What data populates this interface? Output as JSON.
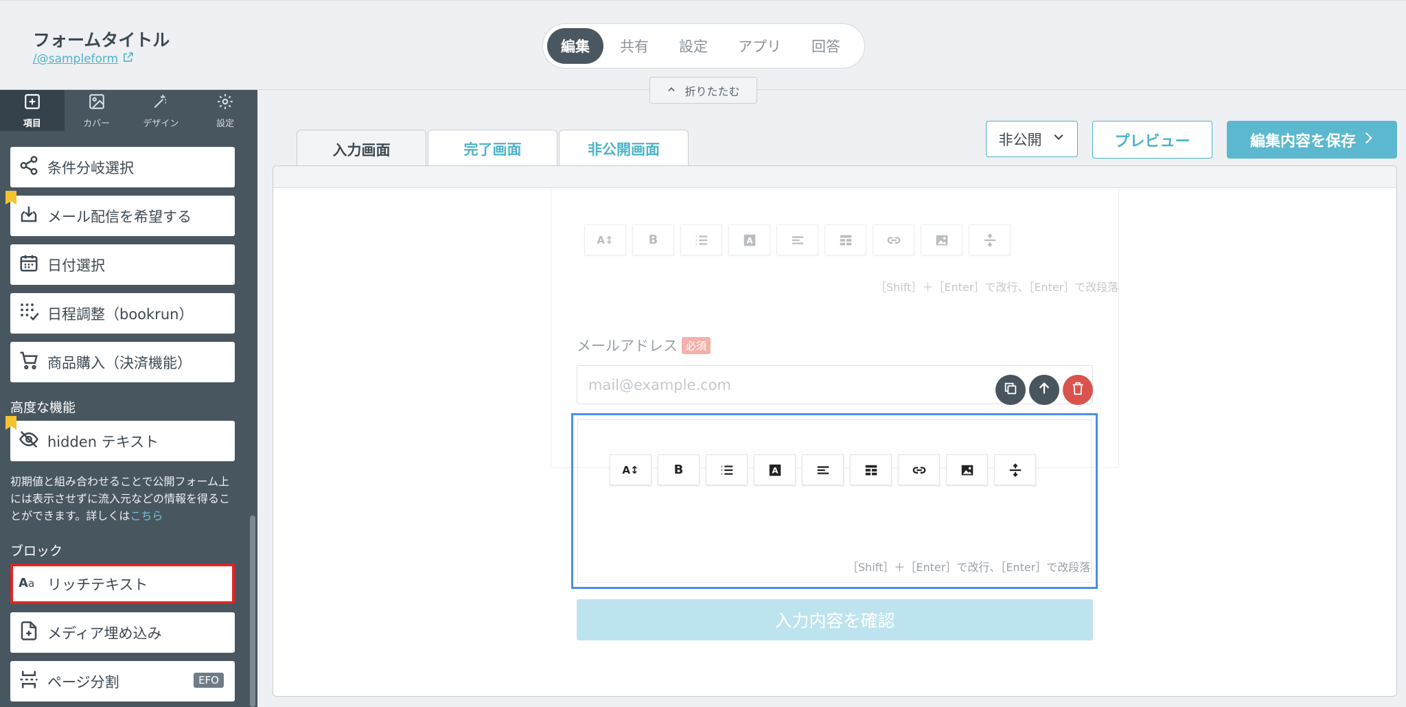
{
  "header": {
    "form_title": "フォームタイトル",
    "form_url": "/@sampleform",
    "mode_tabs": [
      "編集",
      "共有",
      "設定",
      "アプリ",
      "回答"
    ],
    "fold_label": "折りたたむ"
  },
  "sidebar": {
    "tabs": [
      {
        "label": "項目",
        "icon": "plus-square-icon"
      },
      {
        "label": "カバー",
        "icon": "image-icon"
      },
      {
        "label": "デザイン",
        "icon": "magic-wand-icon"
      },
      {
        "label": "設定",
        "icon": "gear-icon"
      }
    ],
    "items": [
      {
        "label": "条件分岐選択",
        "icon": "branch-icon"
      },
      {
        "label": "メール配信を希望する",
        "icon": "mail-inbox-icon"
      },
      {
        "label": "日付選択",
        "icon": "calendar-icon"
      },
      {
        "label": "日程調整（bookrun）",
        "icon": "schedule-grid-icon"
      },
      {
        "label": "商品購入（決済機能）",
        "icon": "cart-icon"
      }
    ],
    "advanced_title": "高度な機能",
    "hidden_text": {
      "label": "hidden テキスト",
      "icon": "eye-off-icon"
    },
    "note_text": "初期値と組み合わせることで公開フォーム上には表示させずに流入元などの情報を得ることができます。詳しくは",
    "note_link": "こちら",
    "block_title": "ブロック",
    "block_items": [
      {
        "label": "リッチテキスト",
        "icon": "text-aa-icon"
      },
      {
        "label": "メディア埋め込み",
        "icon": "file-plus-icon"
      },
      {
        "label": "ページ分割",
        "icon": "page-split-icon",
        "badge": "EFO"
      }
    ]
  },
  "controls": {
    "visibility": "非公開",
    "preview": "プレビュー",
    "save": "編集内容を保存"
  },
  "screen_tabs": [
    "入力画面",
    "完了画面",
    "非公開画面"
  ],
  "editor": {
    "toolbar_icons": [
      "text-size-icon",
      "bold-icon",
      "list-icon",
      "text-color-icon",
      "align-icon",
      "table-icon",
      "link-icon",
      "image-icon",
      "divider-icon"
    ],
    "bold_glyph": "B",
    "size_glyph": "A↕",
    "hint": "［Shift］＋［Enter］で改行、［Enter］で改段落",
    "email_label": "メールアドレス",
    "required": "必須",
    "email_placeholder": "mail@example.com",
    "confirm": "入力内容を確認"
  },
  "colors": {
    "accent": "#4cb3c9",
    "sidebar_bg": "#485660",
    "selected_border": "#4a8ee6",
    "highlight_red": "#e02424",
    "delete_red": "#d9534f"
  }
}
